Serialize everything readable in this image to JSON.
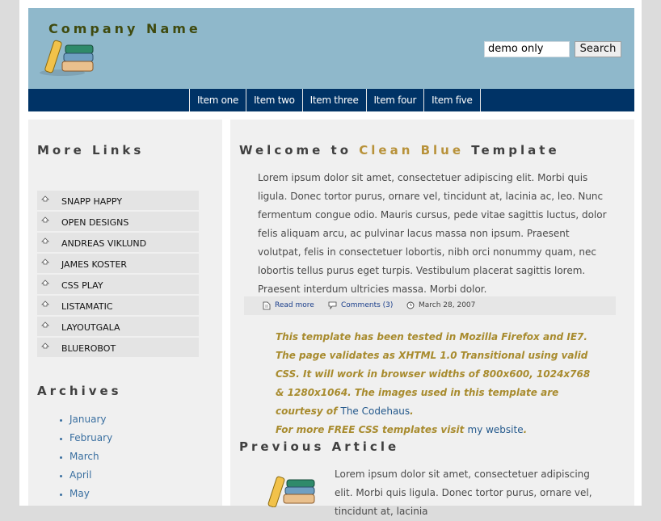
{
  "header": {
    "company_name": "Company Name",
    "search": {
      "value": "demo only",
      "button_label": "Search"
    }
  },
  "nav": {
    "items": [
      "Item one",
      "Item two",
      "Item three",
      "Item four",
      "Item five"
    ]
  },
  "sidebar": {
    "links_title": "More Links",
    "links": [
      "SNAPP HAPPY",
      "OPEN DESIGNS",
      "ANDREAS VIKLUND",
      "JAMES KOSTER",
      "CSS PLAY",
      "LISTAMATIC",
      "LAYOUTGALA",
      "BLUEROBOT"
    ],
    "archives_title": "Archives",
    "archives": [
      "January",
      "February",
      "March",
      "April",
      "May"
    ]
  },
  "main": {
    "title_prefix": "Welcome to ",
    "title_highlight": "Clean Blue",
    "title_suffix": " Template",
    "paragraph": "Lorem ipsum dolor sit amet, consectetuer adipiscing elit. Morbi quis ligula. Donec tortor purus, ornare vel, tincidunt at, lacinia ac, leo. Nunc fermentum congue odio. Mauris cursus, pede vitae sagittis luctus, dolor felis aliquam arcu, ac pulvinar lacus massa non ipsum. Praesent volutpat, felis in consectetuer lobortis, nibh orci nonummy quam, nec lobortis tellus purus eget turpis. Vestibulum placerat sagittis lorem. Praesent interdum ultricies massa. Morbi dolor.",
    "meta": {
      "read_more": "Read more",
      "comments": "Comments (3)",
      "date": "March 28, 2007"
    },
    "note": {
      "line1": "This template has been tested in Mozilla Firefox and IE7. The page validates as XHTML 1.0 Transitional using valid CSS. It will work in browser widths of 800x600, 1024x768 & 1280x1064. The images used in this template are courtesy of ",
      "link1": "The Codehaus",
      "line1_end": ".",
      "line2": "For more FREE CSS templates visit ",
      "link2": "my website",
      "line2_end": "."
    },
    "previous_title": "Previous Article",
    "previous_paragraph": "Lorem ipsum dolor sit amet, consectetuer adipiscing elit. Morbi quis ligula. Donec tortor purus, ornare vel, tincidunt at, lacinia"
  },
  "colors": {
    "header_bg": "#8fb8cb",
    "nav_bg": "#003366",
    "panel_bg": "#f0f0f0",
    "accent_gold": "#b8923a",
    "link_blue": "#3a6fa0"
  }
}
